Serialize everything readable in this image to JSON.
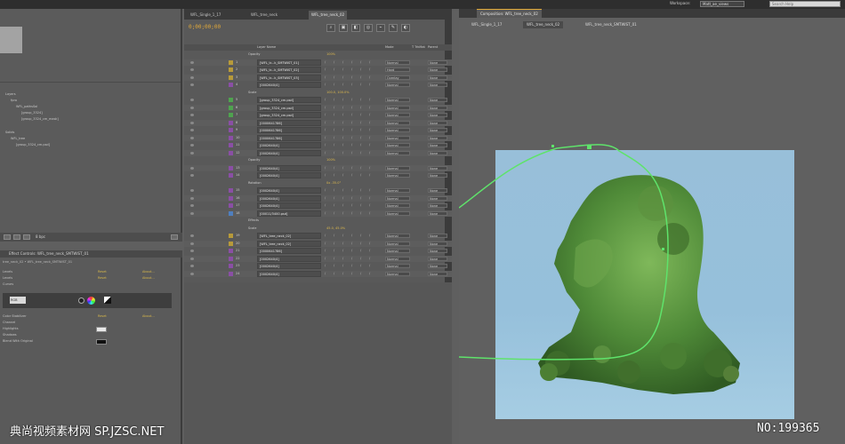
{
  "topbar": {
    "workspace_label": "Workspace:",
    "workspace_value": "Matt_ae_views",
    "search_placeholder": "Search Help"
  },
  "project": {
    "items": [
      {
        "label": "Layers",
        "indent": 0
      },
      {
        "label": "fpro",
        "indent": 1
      },
      {
        "label": "WFL_pathsSol",
        "indent": 2
      },
      {
        "label": "[group_3324]",
        "indent": 3
      },
      {
        "label": "[group_3324_cm_mask]",
        "indent": 3
      },
      {
        "label": "Solids",
        "indent": 0
      },
      {
        "label": "WFL_tree",
        "indent": 1
      },
      {
        "label": "[group_3324_cm.psd]",
        "indent": 2
      }
    ],
    "bpc": "8 bpc"
  },
  "effect_controls": {
    "tab": "Effect Controls: WFL_tree_neck_SMTWIST_01",
    "subtitle": "tree_neck_02 • WFL_tree_neck_SMTWIST_01",
    "rows": [
      {
        "label": "Levels",
        "value": "Reset",
        "extra": "About..."
      },
      {
        "label": "Levels",
        "value": "Reset",
        "extra": "About..."
      },
      {
        "label": "Curves",
        "value": "",
        "extra": ""
      }
    ],
    "wheel_select": "RGB",
    "extra_rows": [
      {
        "label": "Color Stabilizer",
        "value": "Reset",
        "extra": "About..."
      },
      {
        "label": "Channel",
        "value": "",
        "extra": ""
      },
      {
        "label": "Highlights",
        "value": "",
        "extra": ""
      },
      {
        "label": "Shadows",
        "value": "",
        "extra": ""
      },
      {
        "label": "Blend With Original",
        "value": "0.0%",
        "extra": ""
      }
    ]
  },
  "timeline": {
    "tabs": [
      {
        "label": "WFL_Single_1_17",
        "active": false
      },
      {
        "label": "WFL_tree_neck",
        "active": false
      },
      {
        "label": "WFL_tree_neck_02",
        "active": true
      }
    ],
    "timecode": "0;00;00;00",
    "tool_icons": [
      "search-icon",
      "comp-mini-icon",
      "draft-icon",
      "motion-blur-icon",
      "graph-icon",
      "brush-icon",
      "camera-icon"
    ],
    "columns": {
      "layer_name": "Layer Name",
      "mode": "Mode",
      "trkmat": "T TrkMat",
      "parent": "Parent"
    },
    "rows": [
      {
        "kind": "prop",
        "name": "Opacity",
        "value": "100%"
      },
      {
        "kind": "layer",
        "num": "1",
        "name": "[WFL_tr...k_SMTWIST_01]",
        "label_color": "#b79a3a",
        "mode": "Normal",
        "parent": "None"
      },
      {
        "kind": "layer",
        "num": "2",
        "name": "[WFL_tr...k_SMTWIST_02]",
        "label_color": "#b79a3a",
        "mode": "Hard",
        "parent": "None"
      },
      {
        "kind": "layer",
        "num": "3",
        "name": "[WFL_tr...k_SMTWIST_03]",
        "label_color": "#b79a3a",
        "mode": "Overlay",
        "parent": "None"
      },
      {
        "kind": "layer",
        "num": "4",
        "name": "[0002640/4]",
        "label_color": "#8a4fa5",
        "mode": "Normal",
        "parent": "None"
      },
      {
        "kind": "prop",
        "name": "Scale",
        "value": "100.0, 100.0%"
      },
      {
        "kind": "layer",
        "num": "5",
        "name": "[group_3324_cm.psd]",
        "label_color": "#4fa34f",
        "mode": "Normal",
        "parent": "None"
      },
      {
        "kind": "layer",
        "num": "6",
        "name": "[group_3324_cm.psd]",
        "label_color": "#4fa34f",
        "mode": "Normal",
        "parent": "None"
      },
      {
        "kind": "layer",
        "num": "7",
        "name": "[group_3324_cm.psd]",
        "label_color": "#4fa34f",
        "mode": "Normal",
        "parent": "None"
      },
      {
        "kind": "layer",
        "num": "8",
        "name": "[0000641786]",
        "label_color": "#8a4fa5",
        "mode": "Normal",
        "parent": "None"
      },
      {
        "kind": "layer",
        "num": "9",
        "name": "[0000641786]",
        "label_color": "#8a4fa5",
        "mode": "Normal",
        "parent": "None"
      },
      {
        "kind": "layer",
        "num": "10",
        "name": "[0000641786]",
        "label_color": "#8a4fa5",
        "mode": "Normal",
        "parent": "None"
      },
      {
        "kind": "layer",
        "num": "11",
        "name": "[0002640/4]",
        "label_color": "#8a4fa5",
        "mode": "Normal",
        "parent": "None"
      },
      {
        "kind": "layer",
        "num": "12",
        "name": "[0002640/4]",
        "label_color": "#8a4fa5",
        "mode": "Normal",
        "parent": "None"
      },
      {
        "kind": "prop",
        "name": "Opacity",
        "value": "100%"
      },
      {
        "kind": "layer",
        "num": "13",
        "name": "[0002640/4]",
        "label_color": "#8a4fa5",
        "mode": "Normal",
        "parent": "None"
      },
      {
        "kind": "layer",
        "num": "14",
        "name": "[0002640/4]",
        "label_color": "#8a4fa5",
        "mode": "Normal",
        "parent": "None"
      },
      {
        "kind": "prop",
        "name": "Rotation",
        "value": "0x -35.0°"
      },
      {
        "kind": "layer",
        "num": "15",
        "name": "[0002640/4]",
        "label_color": "#8a4fa5",
        "mode": "Normal",
        "parent": "None"
      },
      {
        "kind": "layer",
        "num": "16",
        "name": "[0002640/4]",
        "label_color": "#8a4fa5",
        "mode": "Normal",
        "parent": "None"
      },
      {
        "kind": "layer",
        "num": "17",
        "name": "[0002640/4]",
        "label_color": "#8a4fa5",
        "mode": "Normal",
        "parent": "None"
      },
      {
        "kind": "layer",
        "num": "18",
        "name": "[00011/3400.psd]",
        "label_color": "#4f7fbf",
        "mode": "Normal",
        "parent": "None"
      },
      {
        "kind": "prop",
        "name": "Effects",
        "value": ""
      },
      {
        "kind": "prop",
        "name": "Scale",
        "value": "45.0, 45.0%"
      },
      {
        "kind": "layer",
        "num": "19",
        "name": "[WFL_tree_neck_02]",
        "label_color": "#b79a3a",
        "mode": "Normal",
        "parent": "None"
      },
      {
        "kind": "layer",
        "num": "20",
        "name": "[WFL_tree_neck_02]",
        "label_color": "#b79a3a",
        "mode": "Normal",
        "parent": "None"
      },
      {
        "kind": "layer",
        "num": "21",
        "name": "[0000641786]",
        "label_color": "#8a4fa5",
        "mode": "Normal",
        "parent": "None"
      },
      {
        "kind": "layer",
        "num": "22",
        "name": "[0002640/4]",
        "label_color": "#8a4fa5",
        "mode": "Normal",
        "parent": "None"
      },
      {
        "kind": "layer",
        "num": "23",
        "name": "[0002640/4]",
        "label_color": "#8a4fa5",
        "mode": "Normal",
        "parent": "None"
      },
      {
        "kind": "layer",
        "num": "24",
        "name": "[0002640/4]",
        "label_color": "#8a4fa5",
        "mode": "Normal",
        "parent": "None"
      }
    ]
  },
  "composition": {
    "tab": "Composition: WFL_tree_neck_02",
    "crumbs": [
      {
        "label": "WFL_Single_1_17",
        "active": false
      },
      {
        "label": "WFL_tree_neck_02",
        "active": true
      },
      {
        "label": "WFL_tree_neck_SMTWIST_01",
        "active": false
      }
    ],
    "frame_bg": "#98bfd9",
    "motion_path_color": "#5fe36b"
  },
  "overlay": {
    "watermark": "典尚视频素材网 SP.JZSC.NET",
    "number": "NO:199365"
  },
  "colors": {
    "accent": "#e0a93a",
    "panel": "#5b5b5b"
  }
}
